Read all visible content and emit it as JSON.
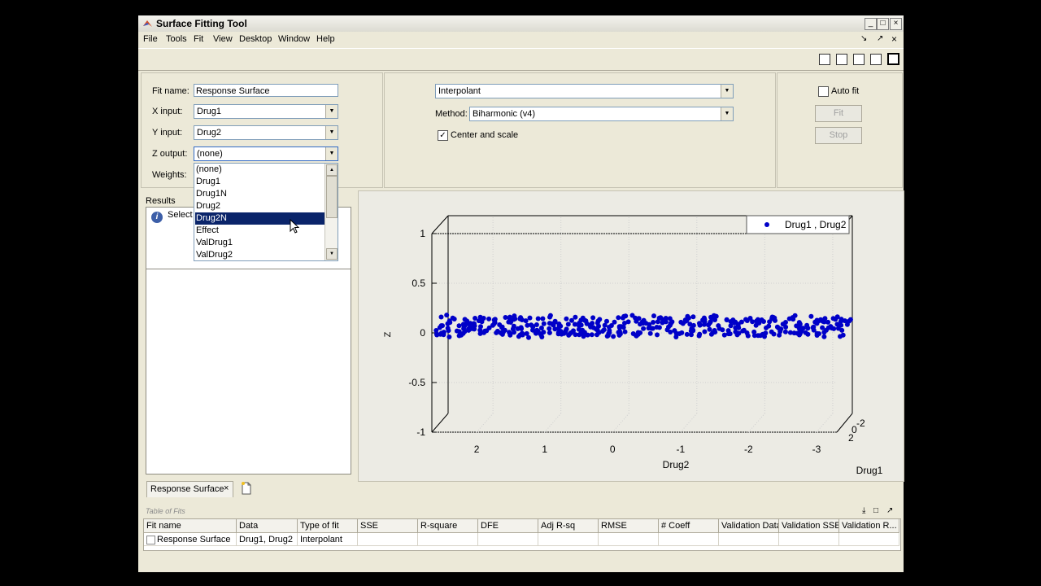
{
  "window": {
    "title": "Surface Fitting Tool"
  },
  "menu": [
    "File",
    "Tools",
    "Fit",
    "View",
    "Desktop",
    "Window",
    "Help"
  ],
  "fit_panel": {
    "fit_name_label": "Fit name:",
    "fit_name_value": "Response Surface",
    "x_input_label": "X input:",
    "x_input_value": "Drug1",
    "y_input_label": "Y input:",
    "y_input_value": "Drug2",
    "z_output_label": "Z output:",
    "z_output_value": "(none)",
    "weights_label": "Weights:"
  },
  "dropdown": {
    "options": [
      "(none)",
      "Drug1",
      "Drug1N",
      "Drug2",
      "Drug2N",
      "Effect",
      "ValDrug1",
      "ValDrug2"
    ],
    "highlighted": "Drug2N"
  },
  "fit_type": {
    "type_value": "Interpolant",
    "method_label": "Method:",
    "method_value": "Biharmonic (v4)",
    "center_scale_label": "Center and scale",
    "center_scale_checked": true
  },
  "actions": {
    "auto_fit_label": "Auto fit",
    "fit_label": "Fit",
    "stop_label": "Stop"
  },
  "results": {
    "label": "Results",
    "message": "Select Z"
  },
  "plot": {
    "legend": "Drug1 , Drug2",
    "z_axis_label": "Z",
    "x_axis_label": "Drug2",
    "y_axis_label": "Drug1",
    "z_ticks": [
      "1",
      "0.5",
      "0",
      "-0.5",
      "-1"
    ],
    "x_ticks": [
      "2",
      "1",
      "0",
      "-1",
      "-2",
      "-3"
    ],
    "y_ticks": [
      "-2",
      "0",
      "2"
    ],
    "point_color": "#0000c8"
  },
  "chart_data": {
    "type": "scatter",
    "series": [
      {
        "name": "Drug1 , Drug2",
        "z": 0
      }
    ],
    "xlabel": "Drug2",
    "ylabel": "Drug1",
    "zlabel": "Z",
    "zlim": [
      -1,
      1
    ],
    "xlim": [
      -3.3,
      2.6
    ],
    "ylim": [
      -2,
      2
    ],
    "grid": true,
    "legend_position": "top-right"
  },
  "tab": {
    "label": "Response Surface",
    "close": "×"
  },
  "table": {
    "title": "Table of Fits",
    "columns": [
      "Fit name",
      "Data",
      "Type of fit",
      "SSE",
      "R-square",
      "DFE",
      "Adj R-sq",
      "RMSE",
      "# Coeff",
      "Validation Data",
      "Validation SSE",
      "Validation R..."
    ],
    "rows": [
      [
        "Response Surface",
        "Drug1, Drug2",
        "Interpolant",
        "",
        "",
        "",
        "",
        "",
        "",
        "",
        "",
        ""
      ]
    ]
  }
}
